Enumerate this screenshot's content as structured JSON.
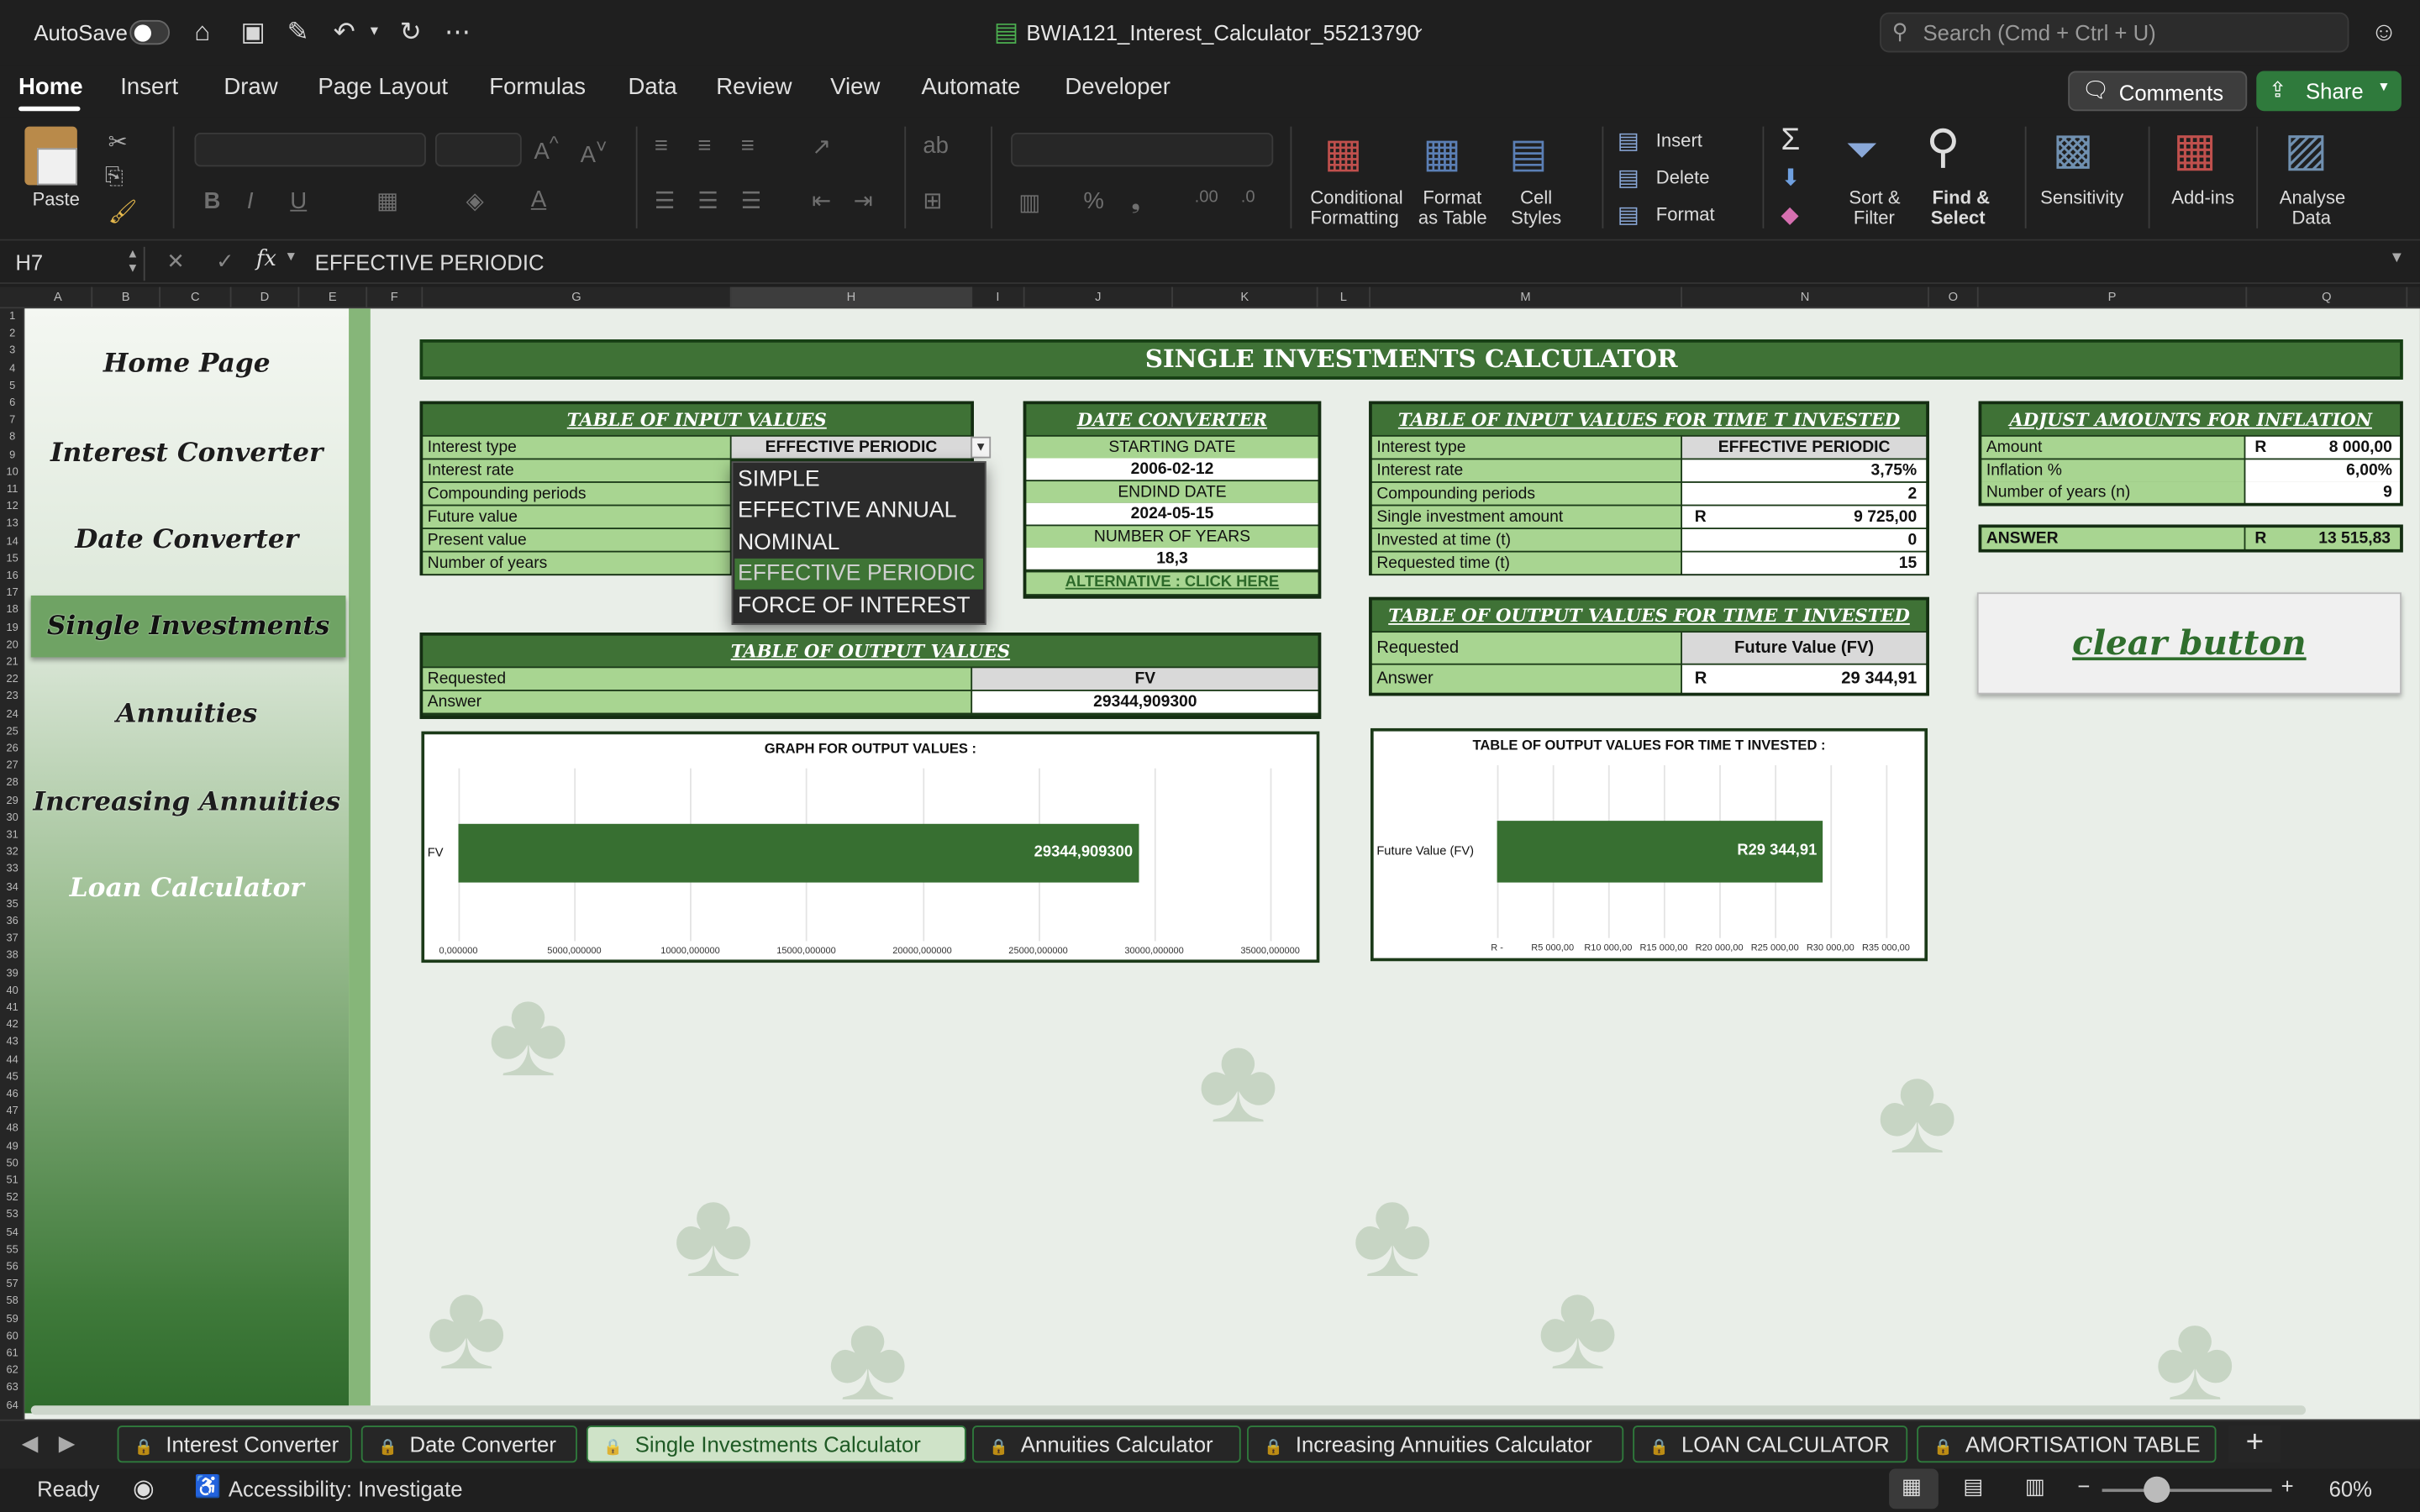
{
  "window": {
    "autosave": "AutoSave",
    "title": "BWIA121_Interest_Calculator_55213790",
    "search_placeholder": "Search (Cmd + Ctrl + U)"
  },
  "ribbon_tabs": [
    "Home",
    "Insert",
    "Draw",
    "Page Layout",
    "Formulas",
    "Data",
    "Review",
    "View",
    "Automate",
    "Developer"
  ],
  "ribbon_buttons": {
    "comments": "Comments",
    "share": "Share",
    "paste": "Paste",
    "conditional_formatting": [
      "Conditional",
      "Formatting"
    ],
    "format_as_table": [
      "Format",
      "as Table"
    ],
    "cell_styles": [
      "Cell",
      "Styles"
    ],
    "insert": "Insert",
    "delete": "Delete",
    "format": "Format",
    "sort_filter": [
      "Sort &",
      "Filter"
    ],
    "find_select": [
      "Find &",
      "Select"
    ],
    "sensitivity": "Sensitivity",
    "addins": "Add-ins",
    "analyse_data": [
      "Analyse",
      "Data"
    ]
  },
  "formula_bar": {
    "cell_ref": "H7",
    "fx": "fx",
    "value": "EFFECTIVE PERIODIC"
  },
  "columns": [
    "A",
    "B",
    "C",
    "D",
    "E",
    "F",
    "G",
    "H",
    "I",
    "J",
    "K",
    "L",
    "M",
    "N",
    "O",
    "P",
    "Q"
  ],
  "nav": [
    "Home Page",
    "Interest Converter",
    "Date Converter",
    "Single Investments",
    "Annuities",
    "Increasing Annuities",
    "Loan Calculator"
  ],
  "banner": "SINGLE INVESTMENTS CALCULATOR",
  "input_table": {
    "title": "TABLE OF INPUT VALUES",
    "labels": [
      "Interest type",
      "Interest rate",
      "Compounding periods",
      "Future value",
      "Present value",
      "Number of years"
    ],
    "interest_type_value": "EFFECTIVE PERIODIC"
  },
  "dropdown": {
    "options": [
      "SIMPLE",
      "EFFECTIVE ANNUAL",
      "NOMINAL",
      "EFFECTIVE PERIODIC",
      "FORCE OF INTEREST"
    ],
    "selected_index": 3
  },
  "date_converter": {
    "title": "DATE CONVERTER",
    "starting_label": "STARTING DATE",
    "starting_value": "2006-02-12",
    "ending_label": "ENDIND DATE",
    "ending_value": "2024-05-15",
    "years_label": "NUMBER OF YEARS",
    "years_value": "18,3",
    "link": "ALTERNATIVE : CLICK HERE"
  },
  "output_table": {
    "title": "TABLE OF OUTPUT VALUES",
    "requested_label": "Requested",
    "requested_value": "FV",
    "answer_label": "Answer",
    "answer_value": "29344,909300"
  },
  "time_t_input": {
    "title": "TABLE OF INPUT VALUES FOR TIME T INVESTED",
    "rows": [
      {
        "label": "Interest type",
        "prefix": "",
        "value": "EFFECTIVE PERIODIC"
      },
      {
        "label": "Interest rate",
        "prefix": "",
        "value": "3,75%"
      },
      {
        "label": "Compounding periods",
        "prefix": "",
        "value": "2"
      },
      {
        "label": "Single investment amount",
        "prefix": "R",
        "value": "9 725,00"
      },
      {
        "label": "Invested at time (t)",
        "prefix": "",
        "value": "0"
      },
      {
        "label": "Requested time (t)",
        "prefix": "",
        "value": "15"
      }
    ]
  },
  "time_t_output": {
    "title": "TABLE OF OUTPUT VALUES FOR TIME T INVESTED",
    "requested_label": "Requested",
    "requested_value": "Future Value (FV)",
    "answer_label": "Answer",
    "answer_prefix": "R",
    "answer_value": "29 344,91"
  },
  "inflation": {
    "title": "ADJUST AMOUNTS FOR INFLATION",
    "rows": [
      {
        "label": "Amount",
        "prefix": "R",
        "value": "8 000,00"
      },
      {
        "label": "Inflation %",
        "prefix": "",
        "value": "6,00%"
      },
      {
        "label": "Number of years (n)",
        "prefix": "",
        "value": "9"
      }
    ],
    "answer_label": "ANSWER",
    "answer_prefix": "R",
    "answer_value": "13 515,83"
  },
  "clear_button": "clear button",
  "chart_data": [
    {
      "type": "bar",
      "title": "GRAPH FOR OUTPUT VALUES :",
      "categories": [
        "FV"
      ],
      "values": [
        29344.9093
      ],
      "data_labels": [
        "29344,909300"
      ],
      "xlim": [
        0,
        35000
      ],
      "ticks": [
        "0,000000",
        "5000,000000",
        "10000,000000",
        "15000,000000",
        "20000,000000",
        "25000,000000",
        "30000,000000",
        "35000,000000"
      ]
    },
    {
      "type": "bar",
      "title": "TABLE OF OUTPUT VALUES FOR TIME T INVESTED :",
      "categories": [
        "Future Value (FV)"
      ],
      "values": [
        29344.91
      ],
      "data_labels": [
        "R29 344,91"
      ],
      "xlim": [
        0,
        35000
      ],
      "ticks": [
        "R -",
        "R5 000,00",
        "R10 000,00",
        "R15 000,00",
        "R20 000,00",
        "R25 000,00",
        "R30 000,00",
        "R35 000,00"
      ]
    }
  ],
  "sheet_tabs": [
    "Interest Converter",
    "Date Converter",
    "Single Investments Calculator",
    "Annuities Calculator",
    "Increasing Annuities Calculator",
    "LOAN CALCULATOR",
    "AMORTISATION TABLE"
  ],
  "active_sheet_index": 2,
  "status": {
    "ready": "Ready",
    "accessibility": "Accessibility: Investigate",
    "zoom": "60%"
  },
  "colors": {
    "dark_green": "#3f7236",
    "light_green": "#a8d591",
    "border_green": "#1b3a18",
    "accent": "#2f7a3c"
  }
}
